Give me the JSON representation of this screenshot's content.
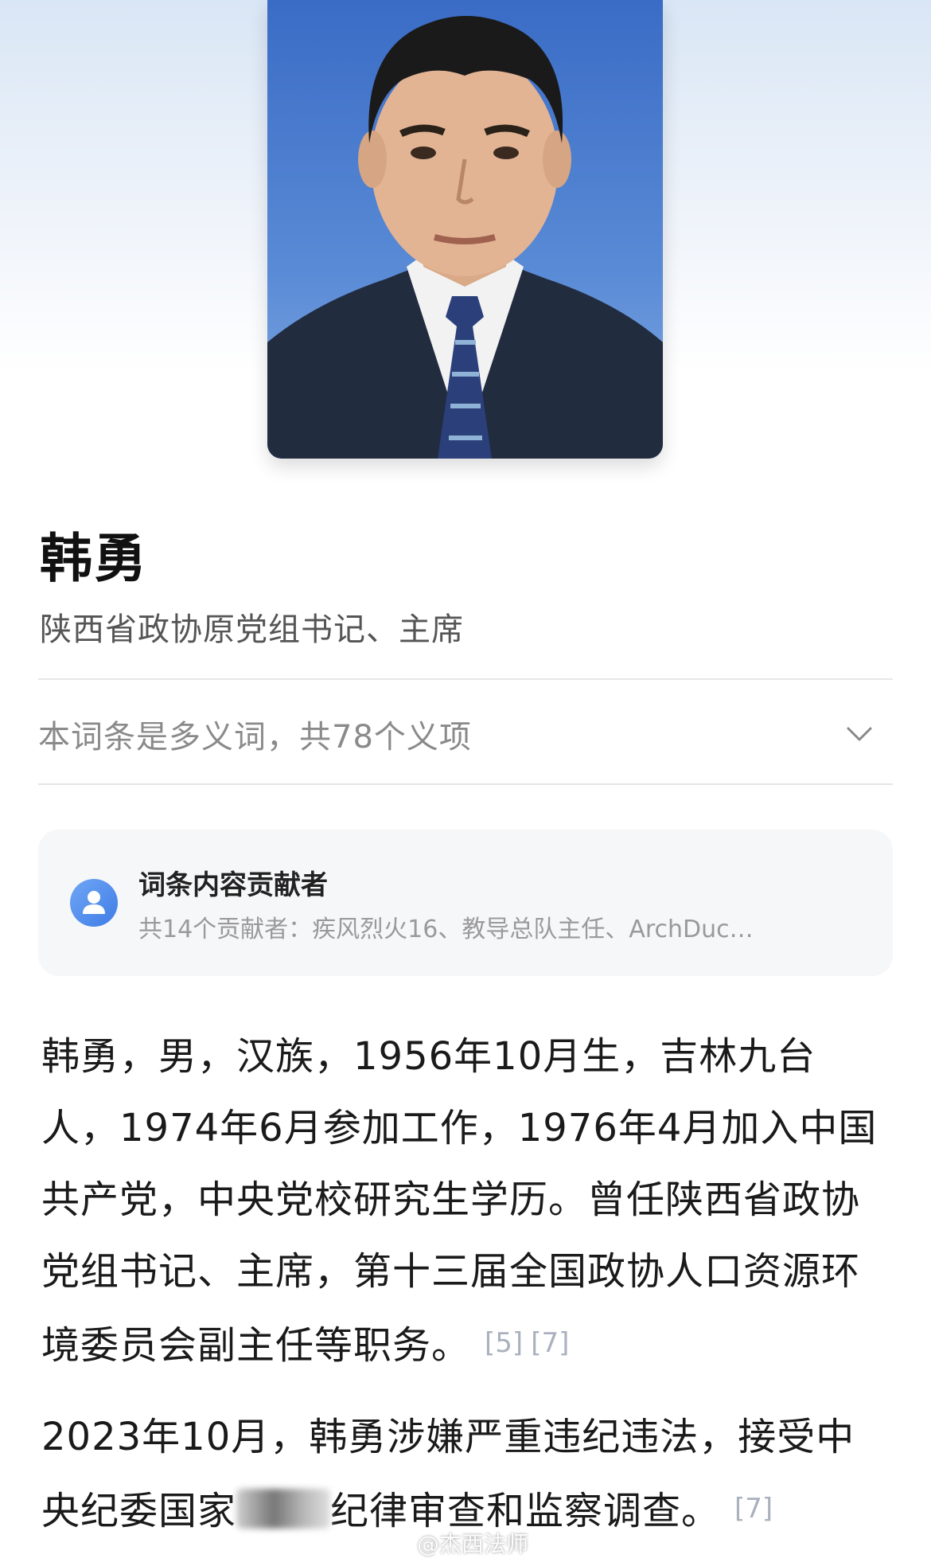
{
  "entry": {
    "name": "韩勇",
    "subtitle": "陕西省政协原党组书记、主席"
  },
  "polysemy": {
    "text": "本词条是多义词，共78个义项"
  },
  "contributors": {
    "title": "词条内容贡献者",
    "summary": "共14个贡献者：疾风烈火16、教导总队主任、ArchDuc…"
  },
  "paragraphs": [
    {
      "text": "韩勇，男，汉族，1956年10月生，吉林九台人，1974年6月参加工作，1976年4月加入中国共产党，中央党校研究生学历。曾任陕西省政协党组书记、主席，第十三届全国政协人口资源环境委员会副主任等职务。",
      "citations": [
        "[5]",
        "[7]"
      ]
    },
    {
      "text_before": "2023年10月，韩勇涉嫌严重违纪违法，接受中央纪委国家",
      "text_after": "纪律审查和监察调查。",
      "citations": [
        "[7]"
      ]
    }
  ],
  "watermark": "@杰西法师",
  "colors": {
    "accent": "#3f7de6",
    "citation": "#aab1bd",
    "muted": "#8a8a8a"
  },
  "icons": {
    "polysemy_toggle": "chevron-down-icon",
    "contributor": "user-avatar-icon",
    "watermark": "weibo-icon"
  }
}
